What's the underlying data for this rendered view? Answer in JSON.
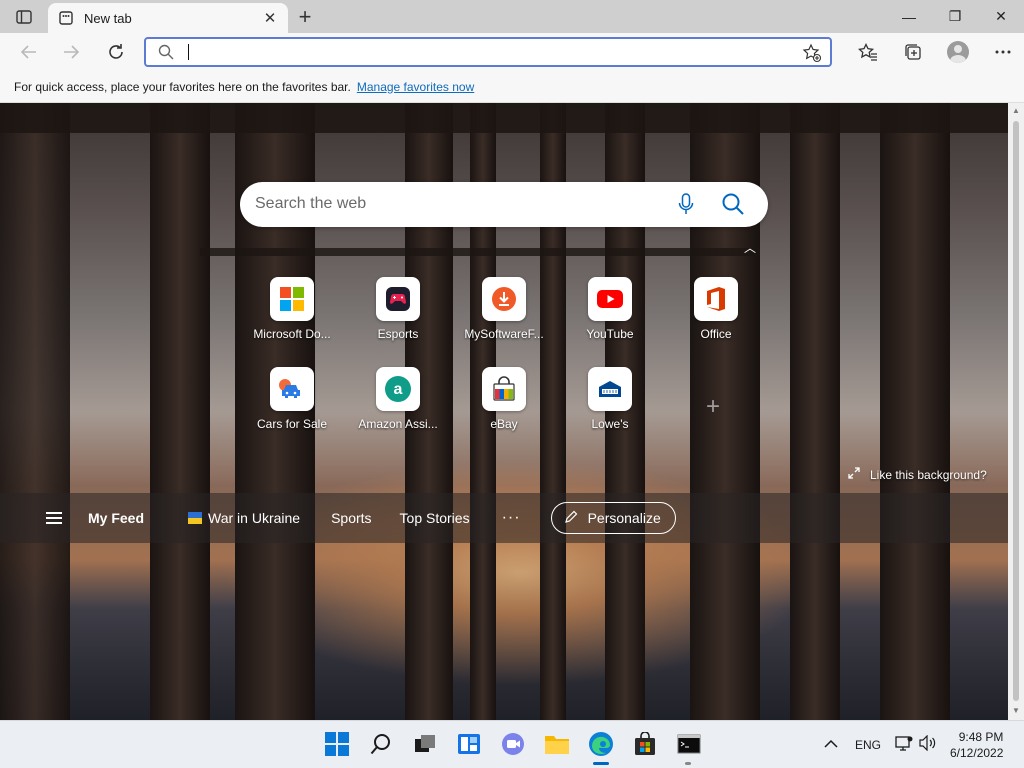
{
  "browser": {
    "tab": {
      "title": "New tab",
      "close_label": "✕"
    },
    "new_tab_label": "+",
    "window_controls": {
      "minimize": "—",
      "restore": "❐",
      "close": "✕"
    },
    "address": {
      "value": "",
      "placeholder": ""
    }
  },
  "favorites_bar": {
    "message": "For quick access, place your favorites here on the favorites bar.",
    "link": "Manage favorites now"
  },
  "newtab": {
    "search_placeholder": "Search the web",
    "tiles": [
      {
        "label": "Microsoft Do...",
        "icon": "microsoft-logo-icon"
      },
      {
        "label": "Esports",
        "icon": "gamepad-icon"
      },
      {
        "label": "MySoftwareF...",
        "icon": "download-icon"
      },
      {
        "label": "YouTube",
        "icon": "youtube-icon"
      },
      {
        "label": "Office",
        "icon": "office-icon"
      },
      {
        "label": "Cars for Sale",
        "icon": "car-icon"
      },
      {
        "label": "Amazon Assi...",
        "icon": "amazon-icon"
      },
      {
        "label": "eBay",
        "icon": "ebay-bag-icon"
      },
      {
        "label": "Lowe's",
        "icon": "lowes-icon"
      }
    ],
    "like_background": "Like this background?",
    "feed": {
      "my_feed": "My Feed",
      "items": [
        "War in Ukraine",
        "Sports",
        "Top Stories"
      ],
      "more": "···",
      "personalize": "Personalize"
    }
  },
  "taskbar": {
    "language": "ENG",
    "time": "9:48 PM",
    "date": "6/12/2022"
  },
  "colors": {
    "accent": "#0067c0",
    "address_border": "#5b7bd5",
    "link": "#0f6cbd"
  }
}
